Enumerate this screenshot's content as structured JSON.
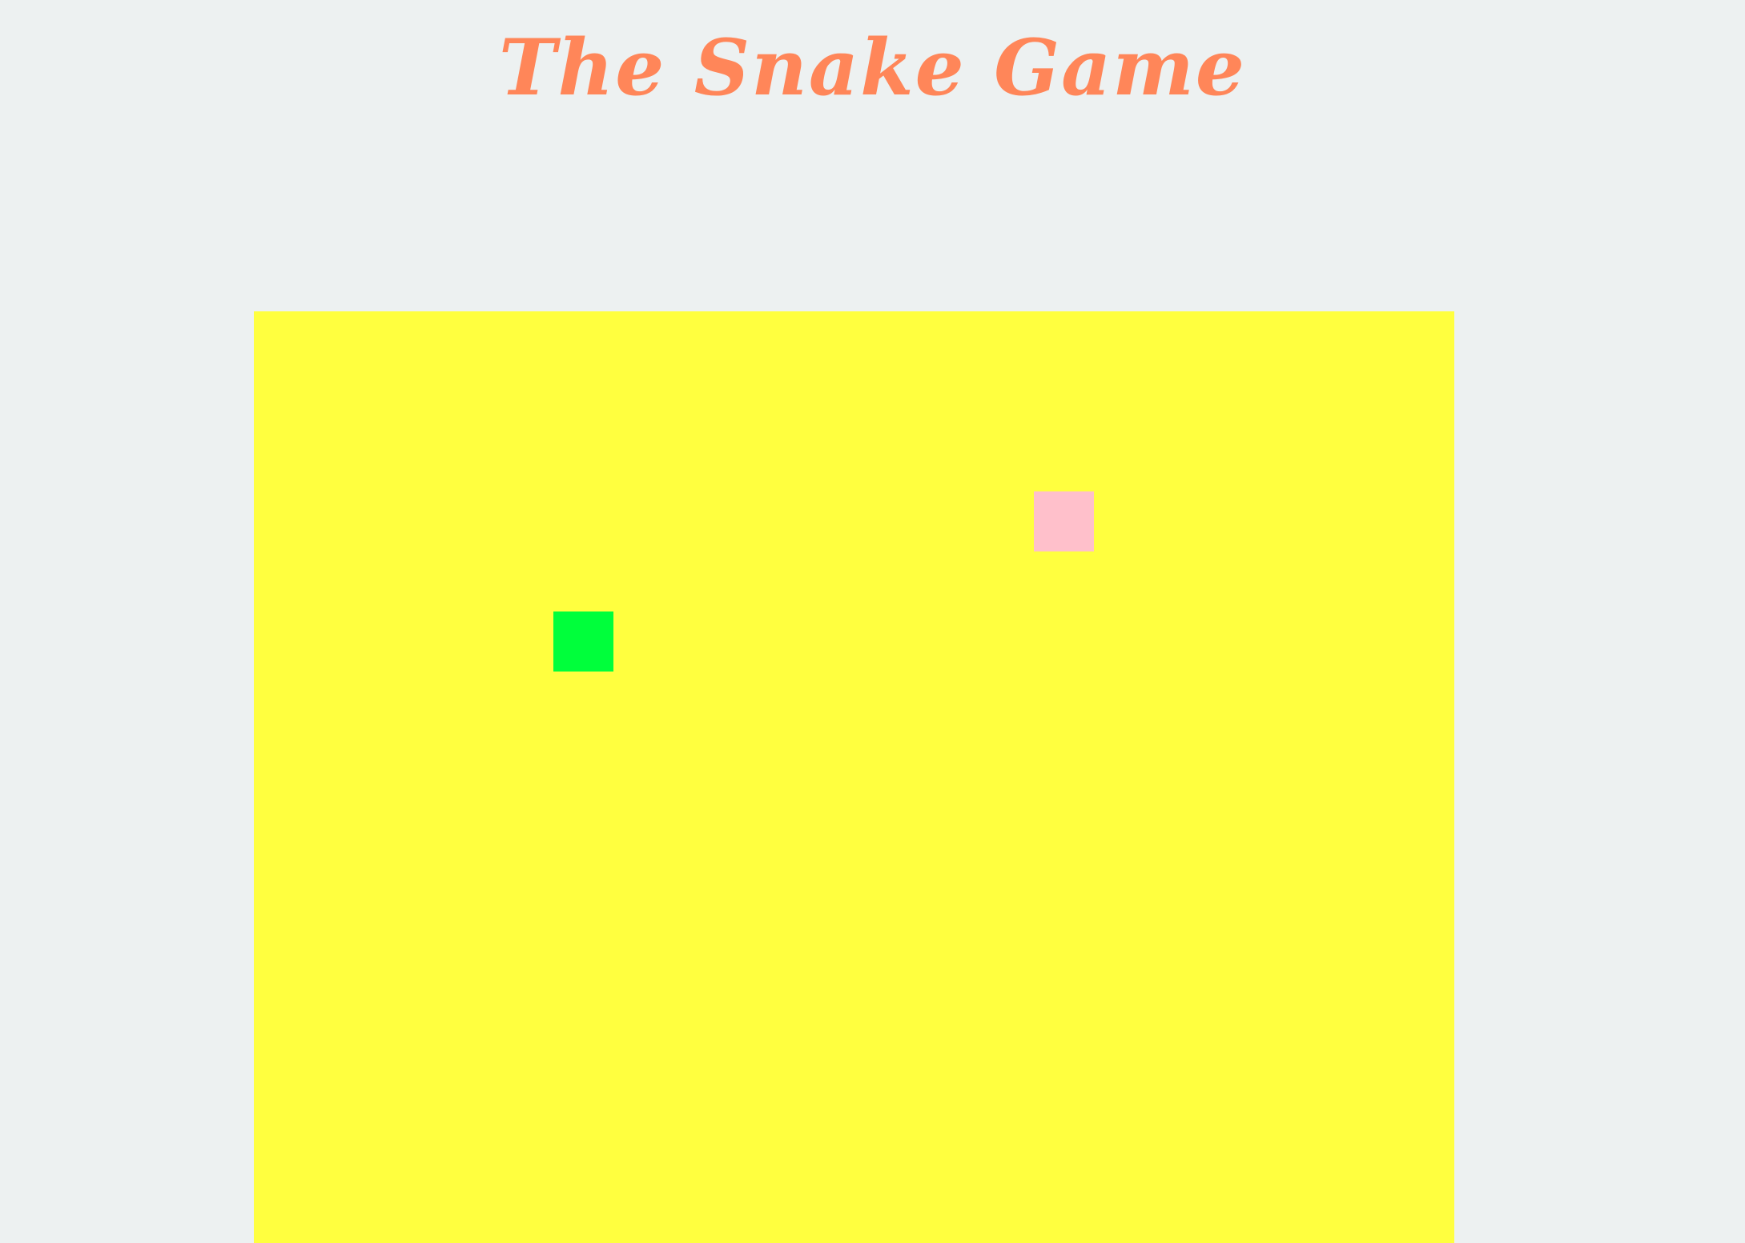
{
  "header": {
    "title": "The Snake Game"
  },
  "colors": {
    "page_background": "#edf1f1",
    "title": "#ff8659",
    "board": "#ffff3f",
    "snake": "#00ff3b",
    "food": "#ffc0cb"
  },
  "game": {
    "snake_segments": 1,
    "food_items": 1
  }
}
